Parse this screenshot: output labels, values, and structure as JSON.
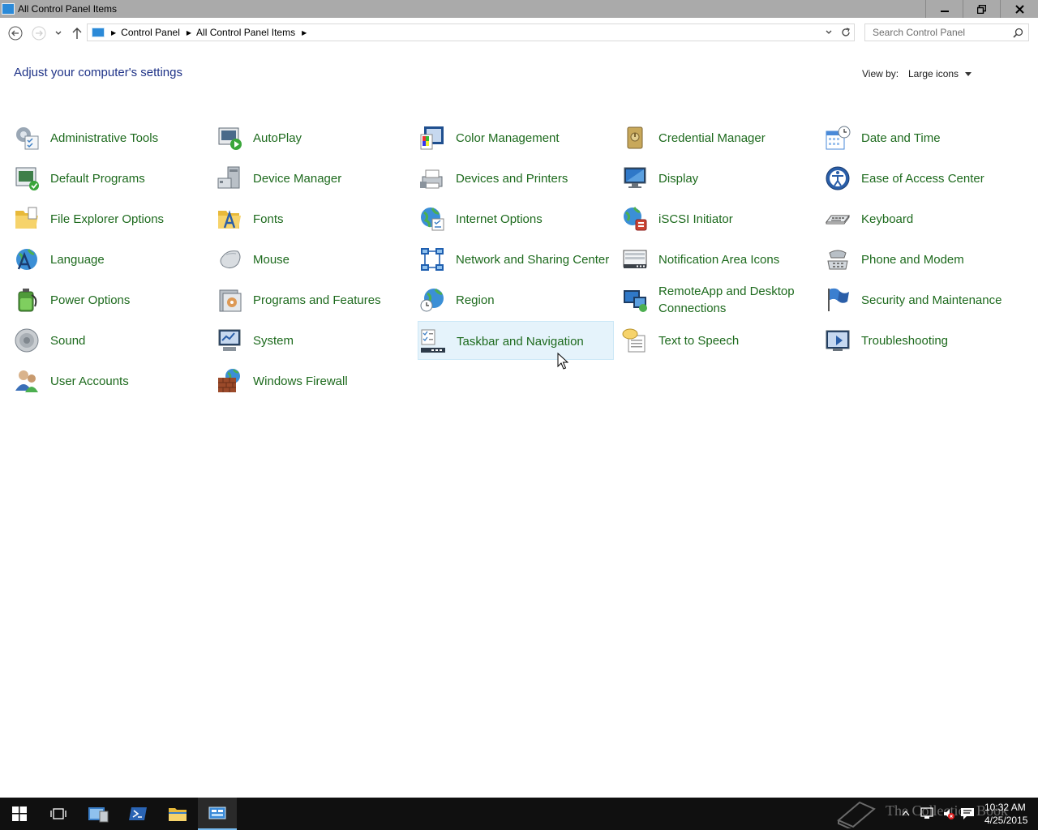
{
  "window": {
    "title": "All Control Panel Items"
  },
  "address_bar": {
    "breadcrumbs": [
      "Control Panel",
      "All Control Panel Items"
    ]
  },
  "search": {
    "placeholder": "Search Control Panel"
  },
  "header": {
    "title": "Adjust your computer's settings",
    "view_by_label": "View by:",
    "view_by_value": "Large icons"
  },
  "items": [
    {
      "label": "Administrative Tools",
      "icon": "admin-tools-icon"
    },
    {
      "label": "AutoPlay",
      "icon": "autoplay-icon"
    },
    {
      "label": "Color Management",
      "icon": "color-management-icon"
    },
    {
      "label": "Credential Manager",
      "icon": "credential-manager-icon"
    },
    {
      "label": "Date and Time",
      "icon": "date-time-icon"
    },
    {
      "label": "Default Programs",
      "icon": "default-programs-icon"
    },
    {
      "label": "Device Manager",
      "icon": "device-manager-icon"
    },
    {
      "label": "Devices and Printers",
      "icon": "devices-printers-icon"
    },
    {
      "label": "Display",
      "icon": "display-icon"
    },
    {
      "label": "Ease of Access Center",
      "icon": "ease-of-access-icon"
    },
    {
      "label": "File Explorer Options",
      "icon": "file-explorer-options-icon"
    },
    {
      "label": "Fonts",
      "icon": "fonts-icon"
    },
    {
      "label": "Internet Options",
      "icon": "internet-options-icon"
    },
    {
      "label": "iSCSI Initiator",
      "icon": "iscsi-initiator-icon"
    },
    {
      "label": "Keyboard",
      "icon": "keyboard-icon"
    },
    {
      "label": "Language",
      "icon": "language-icon"
    },
    {
      "label": "Mouse",
      "icon": "mouse-icon"
    },
    {
      "label": "Network and Sharing Center",
      "icon": "network-sharing-icon"
    },
    {
      "label": "Notification Area Icons",
      "icon": "notification-area-icon"
    },
    {
      "label": "Phone and Modem",
      "icon": "phone-modem-icon"
    },
    {
      "label": "Power Options",
      "icon": "power-options-icon"
    },
    {
      "label": "Programs and Features",
      "icon": "programs-features-icon"
    },
    {
      "label": "Region",
      "icon": "region-icon"
    },
    {
      "label": "RemoteApp and Desktop Connections",
      "icon": "remoteapp-icon"
    },
    {
      "label": "Security and Maintenance",
      "icon": "security-maintenance-icon"
    },
    {
      "label": "Sound",
      "icon": "sound-icon"
    },
    {
      "label": "System",
      "icon": "system-icon"
    },
    {
      "label": "Taskbar and Navigation",
      "icon": "taskbar-navigation-icon"
    },
    {
      "label": "Text to Speech",
      "icon": "text-to-speech-icon"
    },
    {
      "label": "Troubleshooting",
      "icon": "troubleshooting-icon"
    },
    {
      "label": "User Accounts",
      "icon": "user-accounts-icon"
    },
    {
      "label": "Windows Firewall",
      "icon": "windows-firewall-icon"
    }
  ],
  "hovered_item": "Taskbar and Navigation",
  "taskbar": {
    "watermark": "The Collection Book",
    "time": "10:32 AM",
    "date": "4/25/2015"
  },
  "colors": {
    "link_green": "#1d6a1d",
    "heading_blue": "#1e3287",
    "titlebar": "#aaaaaa",
    "taskbar": "#101010",
    "hover_bg": "#e5f3fb"
  }
}
